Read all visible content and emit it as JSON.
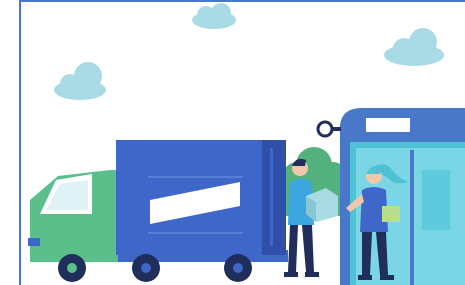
{
  "scene": {
    "subject": "delivery-illustration",
    "colors": {
      "frame": "#4a78c8",
      "sky_cloud": "#a9dbe6",
      "truck_cab": "#5bbf8c",
      "truck_body": "#3f66c9",
      "truck_body_dark": "#2f4fa8",
      "truck_stripe": "#ffffff",
      "bush": "#52b17c",
      "booth": "#4a78c8",
      "booth_inner": "#4ec1d6",
      "person_shirt": "#3ca6e0",
      "person_pants": "#1f2e5a",
      "parcel": "#a8dbe3",
      "parcel_green": "#b9df8e",
      "hair_teal": "#4ec1d6"
    },
    "icons": [
      "cloud-icon",
      "truck-illustration",
      "courier-figure",
      "customer-figure",
      "parcel-box",
      "booth-structure"
    ]
  }
}
